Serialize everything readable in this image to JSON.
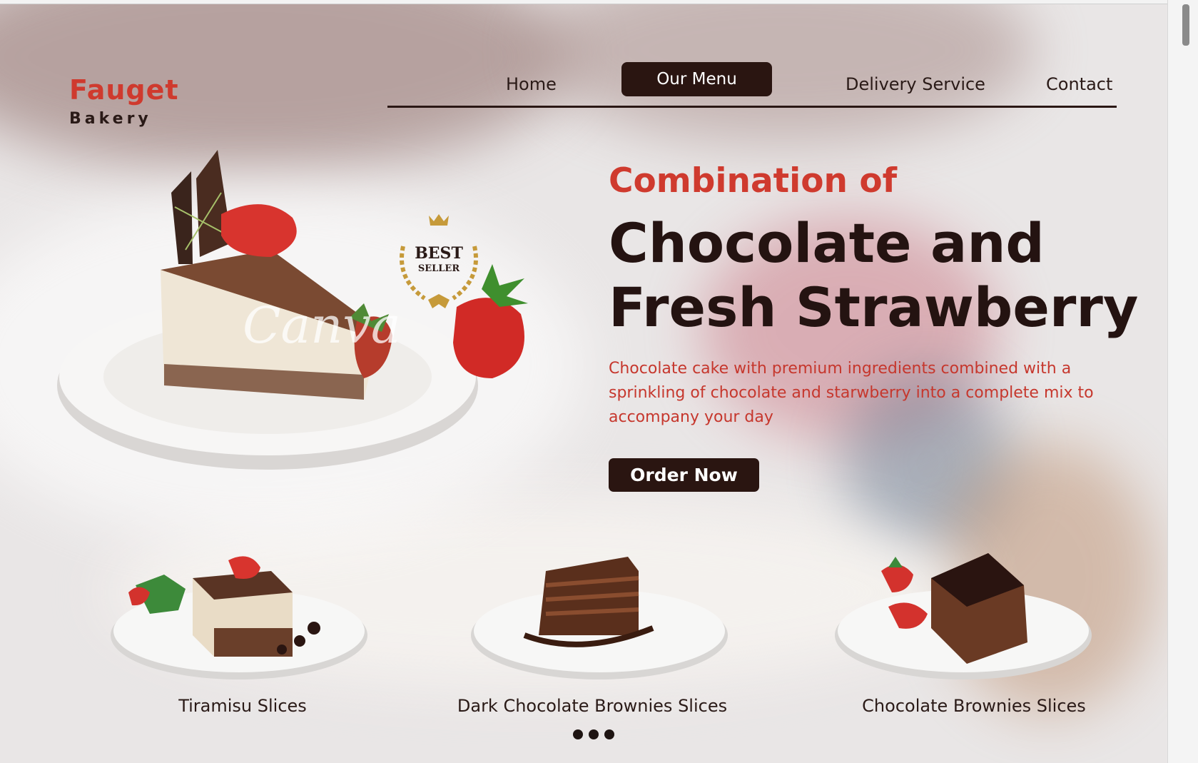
{
  "brand": {
    "name": "Fauget",
    "tagline": "Bakery"
  },
  "nav": {
    "items": [
      {
        "label": "Home"
      },
      {
        "label": "Our Menu",
        "active": true
      },
      {
        "label": "Delivery Service"
      },
      {
        "label": "Contact"
      }
    ]
  },
  "hero": {
    "pre_title": "Combination of",
    "title": "Chocolate and Fresh Strawberry",
    "description": "Chocolate cake with premium ingredients combined with a sprinkling of chocolate and starwberry into a complete mix to accompany your day",
    "cta_label": "Order Now",
    "badge": {
      "line1": "BEST",
      "line2": "SELLER"
    },
    "watermark": "Canva"
  },
  "products": [
    {
      "name": "Tiramisu Slices"
    },
    {
      "name": "Dark Chocolate Brownies Slices"
    },
    {
      "name": "Chocolate Brownies Slices"
    }
  ],
  "colors": {
    "accent": "#cf3a2e",
    "dark": "#2a1511",
    "text": "#2a1a17"
  }
}
